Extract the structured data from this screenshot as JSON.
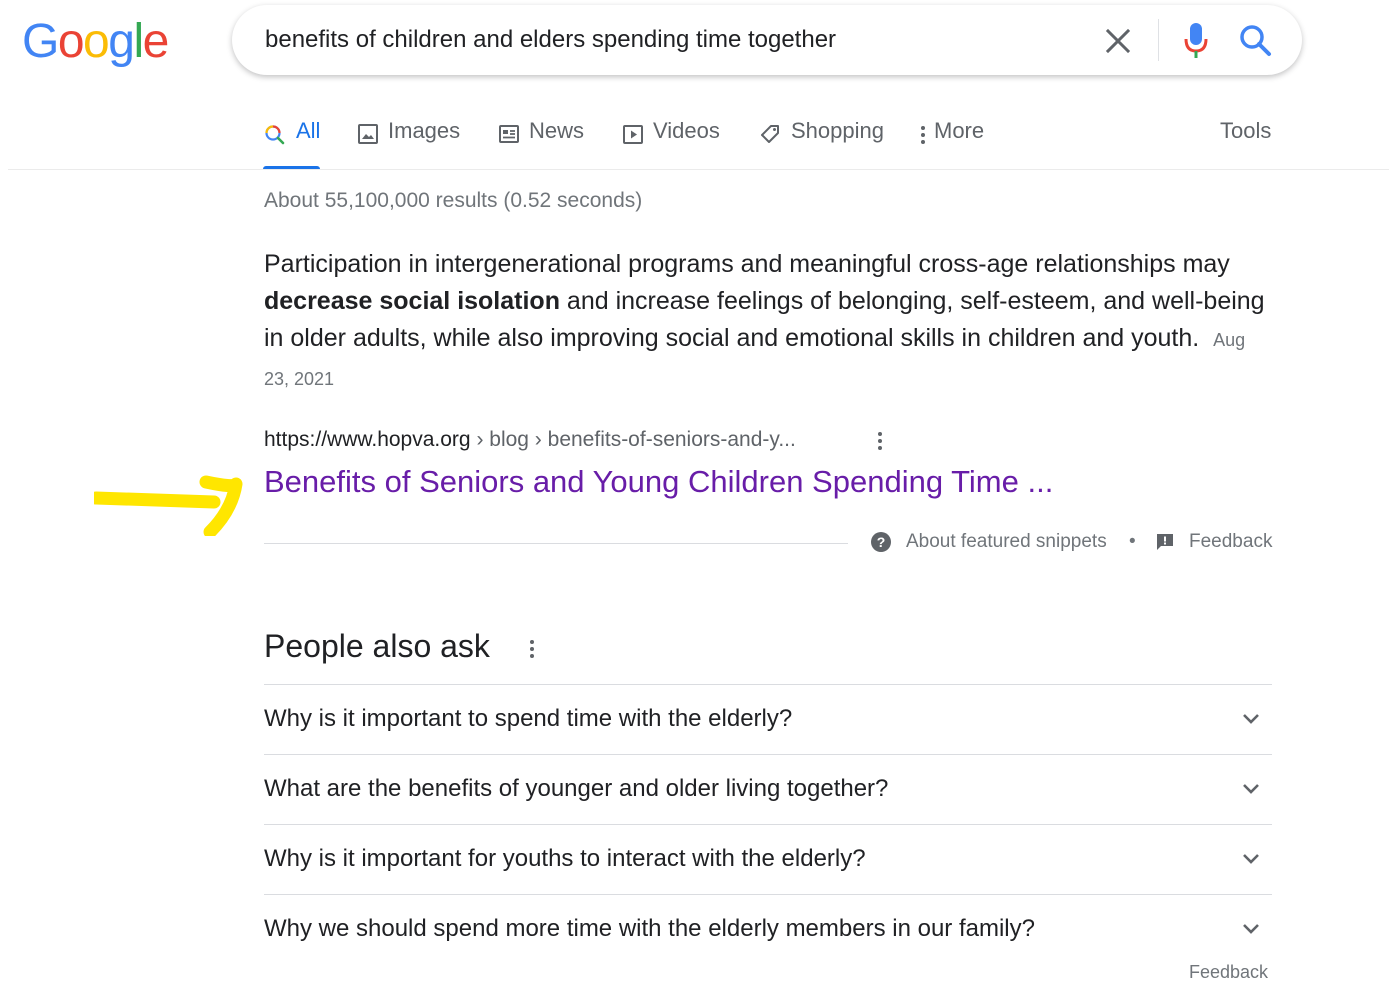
{
  "logo": {
    "letters": [
      {
        "ch": "G",
        "color": "#4285F4"
      },
      {
        "ch": "o",
        "color": "#EA4335"
      },
      {
        "ch": "o",
        "color": "#FBBC05"
      },
      {
        "ch": "g",
        "color": "#4285F4"
      },
      {
        "ch": "l",
        "color": "#34A853"
      },
      {
        "ch": "e",
        "color": "#EA4335"
      }
    ]
  },
  "search": {
    "query": "benefits of children and elders spending time together"
  },
  "tabs": [
    {
      "label": "All",
      "icon": "search-icon",
      "active": true
    },
    {
      "label": "Images",
      "icon": "image-icon",
      "active": false
    },
    {
      "label": "News",
      "icon": "news-icon",
      "active": false
    },
    {
      "label": "Videos",
      "icon": "video-icon",
      "active": false
    },
    {
      "label": "Shopping",
      "icon": "tag-icon",
      "active": false
    },
    {
      "label": "More",
      "icon": "more-vert-icon",
      "active": false
    }
  ],
  "tools_label": "Tools",
  "stats": "About 55,100,000 results (0.52 seconds)",
  "snippet": {
    "text_before": "Participation in intergenerational programs and meaningful cross-age relationships may ",
    "bold": "decrease social isolation",
    "text_after": " and increase feelings of belonging, self-esteem, and well-being in older adults, while also improving social and emotional skills in children and youth.",
    "date": "Aug 23, 2021",
    "cite_domain": "https://www.hopva.org",
    "cite_path": " › blog › benefits-of-seniors-and-y...",
    "title": "Benefits of Seniors and Young Children Spending Time ...",
    "about_label": "About featured snippets",
    "separator": "•",
    "feedback_label": "Feedback"
  },
  "paa": {
    "title": "People also ask",
    "questions": [
      "Why is it important to spend time with the elderly?",
      "What are the benefits of younger and older living together?",
      "Why is it important for youths to interact with the elderly?",
      "Why we should spend more time with the elderly members in our family?"
    ],
    "feedback_label": "Feedback"
  },
  "colors": {
    "accent": "#1a73e8",
    "visited_link": "#681da8",
    "annotation_arrow": "#FFE600"
  }
}
